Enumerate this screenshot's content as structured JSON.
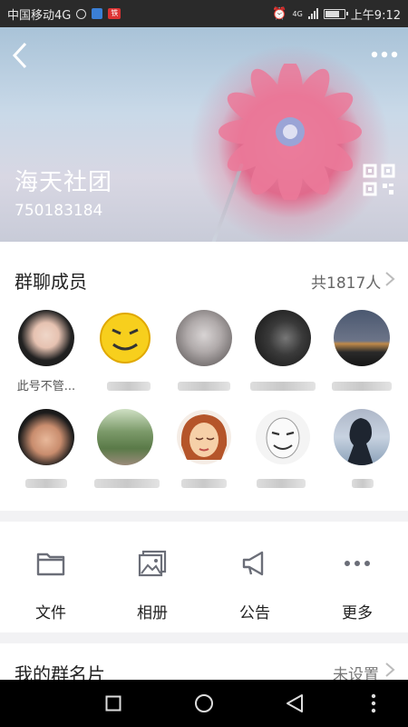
{
  "status_bar": {
    "carrier": "中国移动4G",
    "badge": "铁",
    "network": "4G",
    "time": "上午9:12"
  },
  "header": {
    "group_name": "海天社团",
    "group_id": "750183184"
  },
  "members": {
    "title": "群聊成员",
    "count_label": "共1817人",
    "first_member_name": "此号不管..."
  },
  "actions": [
    {
      "label": "文件",
      "icon": "folder-icon"
    },
    {
      "label": "相册",
      "icon": "album-icon"
    },
    {
      "label": "公告",
      "icon": "megaphone-icon"
    },
    {
      "label": "更多",
      "icon": "more-dots-icon"
    }
  ],
  "my_card": {
    "title": "我的群名片",
    "status": "未设置"
  },
  "colors": {
    "accent_pink": "#e06a8c",
    "icon_gray": "#6b6e78"
  }
}
